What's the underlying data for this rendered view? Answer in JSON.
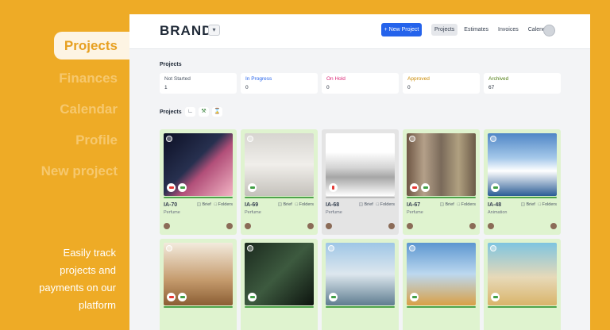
{
  "promo": {
    "nav": [
      "Projects",
      "Finances",
      "Calendar",
      "Profile",
      "New project"
    ],
    "tagline": [
      "Easily track",
      "projects and",
      "payments on our",
      "platform"
    ]
  },
  "header": {
    "brand": "BRAND",
    "new_project": "+ New Project",
    "nav": [
      "Projects",
      "Estimates",
      "Invoices",
      "Calendar"
    ]
  },
  "overview": {
    "title": "Projects",
    "statuses": [
      {
        "label": "Not Started",
        "count": "1",
        "color": "#4b5563"
      },
      {
        "label": "In Progress",
        "count": "0",
        "color": "#2563eb"
      },
      {
        "label": "On Hold",
        "count": "0",
        "color": "#db2777"
      },
      {
        "label": "Approved",
        "count": "0",
        "color": "#ca8a04"
      },
      {
        "label": "Archived",
        "count": "67",
        "color": "#4d7c0f"
      }
    ]
  },
  "projects": {
    "title": "Projects",
    "brief_label": "Brief",
    "folders_label": "Folders",
    "cards": [
      {
        "id": "IA-70",
        "type": "Perfume",
        "thumb": "linear-gradient(135deg,#0c0f24 0%,#27304f 45%,#b24f79 60%,#f2b4c4 100%)",
        "gray": false
      },
      {
        "id": "IA-69",
        "type": "Perfume",
        "thumb": "linear-gradient(180deg,#d7d5d0 0%,#f0eeea 50%,#c4c1bb 100%)",
        "gray": false
      },
      {
        "id": "IA-68",
        "type": "Perfume",
        "thumb": "linear-gradient(180deg,#ffffff 0%,#ffffff 30%,#d4d4d4 55%,#a6a6a6 70%,#ffffff 100%)",
        "gray": true
      },
      {
        "id": "IA-67",
        "type": "Perfume",
        "thumb": "linear-gradient(90deg,#6e5644 0%,#b4a089 25%,#7a6a5a 50%,#b0a080 75%,#6b5a48 100%)",
        "gray": false
      },
      {
        "id": "IA-48",
        "type": "Animation",
        "thumb": "linear-gradient(180deg,#4f86c6 0%,#a6c9ea 40%,#ffffff 60%,#2b5d95 100%)",
        "gray": false
      },
      {
        "id": "",
        "type": "",
        "thumb": "linear-gradient(180deg,#f3ebdd 0%,#c49a6c 60%,#8b5e34 100%)",
        "gray": false
      },
      {
        "id": "",
        "type": "",
        "thumb": "linear-gradient(135deg,#1b2a1e 0%,#3d5a3f 50%,#0d140f 100%)",
        "gray": false
      },
      {
        "id": "",
        "type": "",
        "thumb": "linear-gradient(180deg,#9ec6e6 0%,#dde7ee 50%,#5f7d90 100%)",
        "gray": false
      },
      {
        "id": "",
        "type": "",
        "thumb": "linear-gradient(180deg,#5c96d0 0%,#bcd8ef 50%,#d9a046 100%)",
        "gray": false
      },
      {
        "id": "",
        "type": "",
        "thumb": "linear-gradient(180deg,#7ec4e0 0%,#e7d9b8 55%,#d9b46a 100%)",
        "gray": false
      }
    ]
  }
}
